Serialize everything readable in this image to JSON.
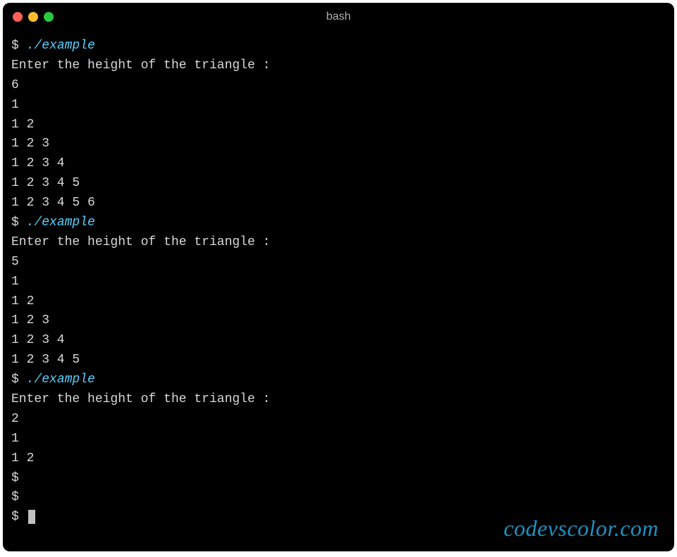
{
  "window": {
    "title": "bash"
  },
  "prompt": "$",
  "terminal": {
    "lines": [
      {
        "type": "cmd",
        "prompt": "$ ",
        "command": "./example"
      },
      {
        "type": "out",
        "text": "Enter the height of the triangle :"
      },
      {
        "type": "out",
        "text": "6"
      },
      {
        "type": "out",
        "text": "1"
      },
      {
        "type": "out",
        "text": "1 2"
      },
      {
        "type": "out",
        "text": "1 2 3"
      },
      {
        "type": "out",
        "text": "1 2 3 4"
      },
      {
        "type": "out",
        "text": "1 2 3 4 5"
      },
      {
        "type": "out",
        "text": "1 2 3 4 5 6"
      },
      {
        "type": "cmd",
        "prompt": "$ ",
        "command": "./example"
      },
      {
        "type": "out",
        "text": "Enter the height of the triangle :"
      },
      {
        "type": "out",
        "text": "5"
      },
      {
        "type": "out",
        "text": "1"
      },
      {
        "type": "out",
        "text": "1 2"
      },
      {
        "type": "out",
        "text": "1 2 3"
      },
      {
        "type": "out",
        "text": "1 2 3 4"
      },
      {
        "type": "out",
        "text": "1 2 3 4 5"
      },
      {
        "type": "cmd",
        "prompt": "$ ",
        "command": "./example"
      },
      {
        "type": "out",
        "text": "Enter the height of the triangle :"
      },
      {
        "type": "out",
        "text": "2"
      },
      {
        "type": "out",
        "text": "1"
      },
      {
        "type": "out",
        "text": "1 2"
      },
      {
        "type": "cmd",
        "prompt": "$",
        "command": ""
      },
      {
        "type": "cmd",
        "prompt": "$",
        "command": ""
      },
      {
        "type": "cmd",
        "prompt": "$ ",
        "command": "",
        "cursor": true
      }
    ]
  },
  "watermark": "codevscolor.com"
}
